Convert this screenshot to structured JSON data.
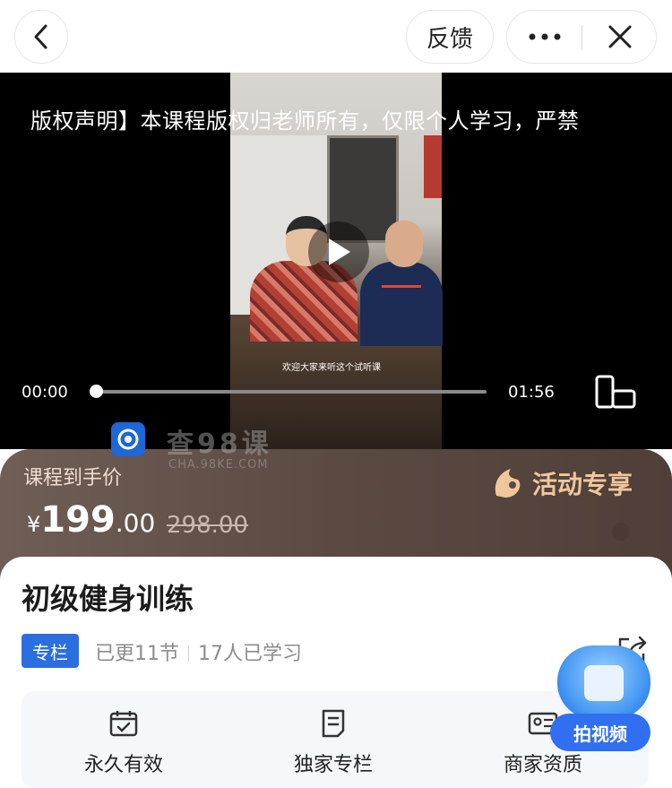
{
  "header": {
    "feedback_label": "反馈",
    "back_icon": "chevron-left-icon",
    "more_icon": "more-dots-icon",
    "close_icon": "close-icon"
  },
  "video": {
    "copyright_text": "版权声明】本课程版权归老师所有，仅限个人学习，严禁",
    "caption_text": "欢迎大家来听这个试听课",
    "current_time": "00:00",
    "total_time": "01:56",
    "progress": 0.0
  },
  "watermark": {
    "text": "查98课",
    "sub": "CHA.98KE.COM"
  },
  "price": {
    "label": "课程到手价",
    "symbol": "¥",
    "integer": "199",
    "decimal": ".00",
    "original": "298.00",
    "activity_label": "活动专享"
  },
  "course": {
    "title": "初级健身训练",
    "tag": "专栏",
    "updated": "已更11节",
    "learners": "17人已学习"
  },
  "features": [
    {
      "label": "永久有效",
      "icon": "calendar-check-icon"
    },
    {
      "label": "独家专栏",
      "icon": "document-icon"
    },
    {
      "label": "商家资质",
      "icon": "id-card-icon"
    }
  ],
  "float_badge": {
    "label": "拍视频"
  },
  "colors": {
    "accent": "#2a6ee0",
    "price_bg": "#5b4a42",
    "activity": "#f0c79a"
  }
}
